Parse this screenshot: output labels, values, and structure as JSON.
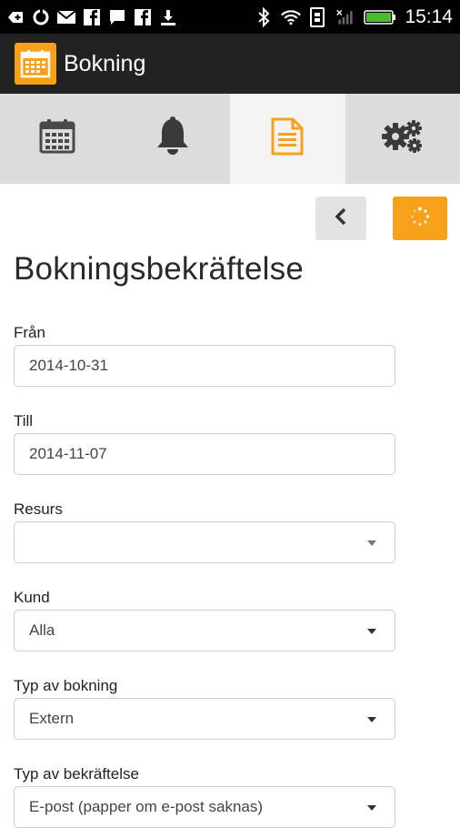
{
  "status_bar": {
    "time": "15:14",
    "left_icons": [
      "add-icon",
      "sync-icon",
      "gmail-icon",
      "facebook-icon",
      "chat-icon",
      "facebook-icon",
      "download-icon"
    ],
    "right_icons": [
      "bluetooth-icon",
      "wifi-icon",
      "nfc-icon",
      "signal-icon",
      "battery-icon"
    ]
  },
  "action_bar": {
    "title": "Bokning",
    "brand_color": "#f7a11a"
  },
  "tabs": [
    {
      "name": "calendar",
      "icon": "calendar-icon",
      "active": false
    },
    {
      "name": "notifications",
      "icon": "bell-icon",
      "active": false
    },
    {
      "name": "document",
      "icon": "document-icon",
      "active": true
    },
    {
      "name": "settings",
      "icon": "gears-icon",
      "active": false
    }
  ],
  "toolbar": {
    "back_icon": "chevron-left-icon",
    "refresh_icon": "loading-spinner-icon"
  },
  "page": {
    "title": "Bokningsbekräftelse"
  },
  "form": {
    "fran": {
      "label": "Från",
      "value": "2014-10-31"
    },
    "till": {
      "label": "Till",
      "value": "2014-11-07"
    },
    "resurs": {
      "label": "Resurs",
      "value": ""
    },
    "kund": {
      "label": "Kund",
      "value": "Alla"
    },
    "typ_bokning": {
      "label": "Typ av bokning",
      "value": "Extern"
    },
    "typ_bekraftelse": {
      "label": "Typ av bekräftelse",
      "value": "E-post (papper om e-post saknas)"
    }
  }
}
